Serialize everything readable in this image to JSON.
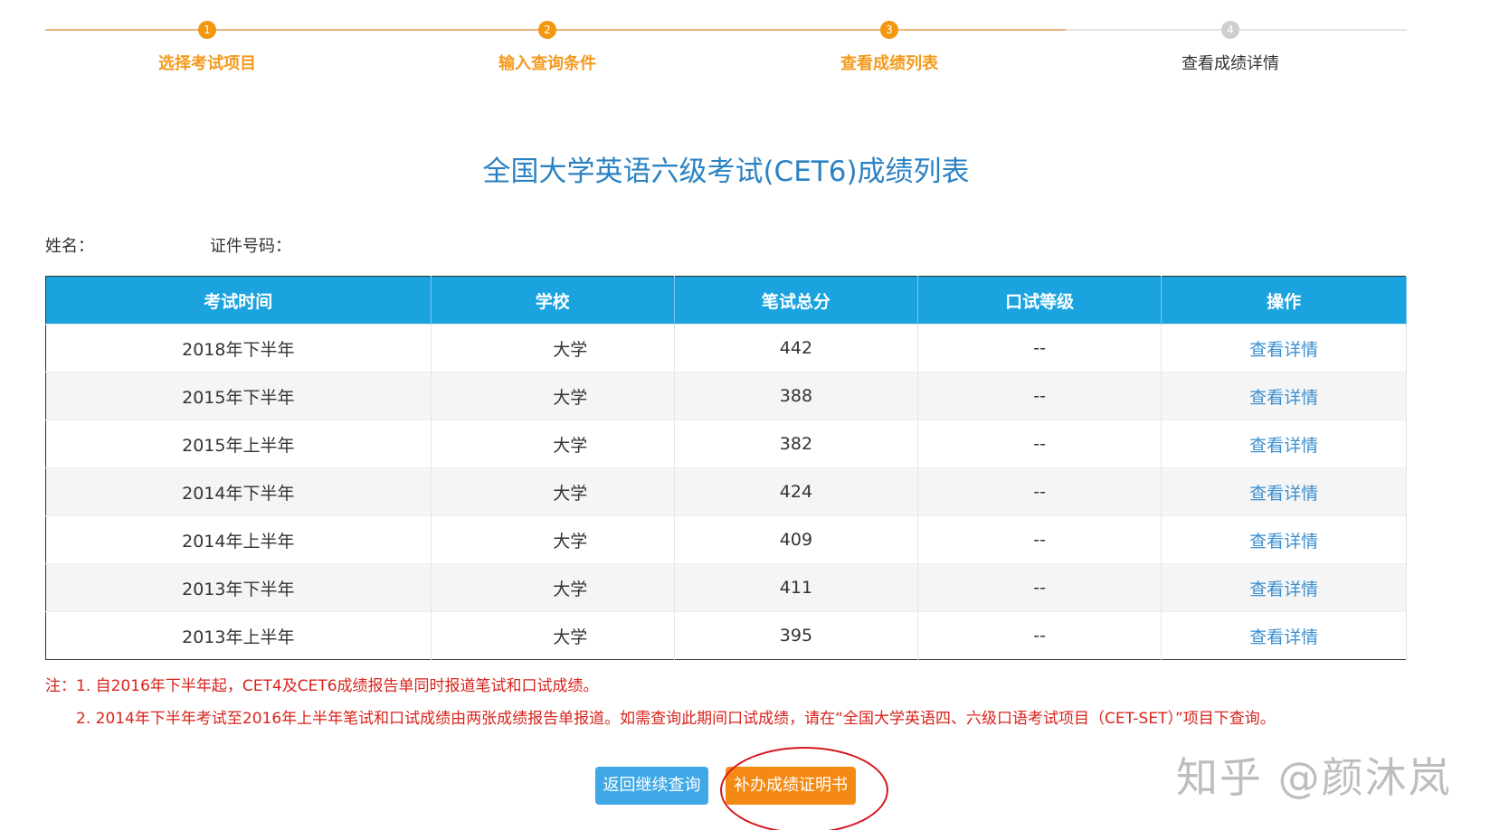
{
  "stepper": {
    "steps": [
      {
        "number": "1",
        "label": "选择考试项目"
      },
      {
        "number": "2",
        "label": "输入查询条件"
      },
      {
        "number": "3",
        "label": "查看成绩列表"
      },
      {
        "number": "4",
        "label": "查看成绩详情"
      }
    ]
  },
  "title": "全国大学英语六级考试(CET6)成绩列表",
  "info": {
    "name_label": "姓名：",
    "id_label": "证件号码："
  },
  "table": {
    "headers": [
      "考试时间",
      "学校",
      "笔试总分",
      "口试等级",
      "操作"
    ],
    "rows": [
      {
        "time": "2018年下半年",
        "school": "大学",
        "score": "442",
        "oral": "--",
        "action": "查看详情"
      },
      {
        "time": "2015年下半年",
        "school": "大学",
        "score": "388",
        "oral": "--",
        "action": "查看详情"
      },
      {
        "time": "2015年上半年",
        "school": "大学",
        "score": "382",
        "oral": "--",
        "action": "查看详情"
      },
      {
        "time": "2014年下半年",
        "school": "大学",
        "score": "424",
        "oral": "--",
        "action": "查看详情"
      },
      {
        "time": "2014年上半年",
        "school": "大学",
        "score": "409",
        "oral": "--",
        "action": "查看详情"
      },
      {
        "time": "2013年下半年",
        "school": "大学",
        "score": "411",
        "oral": "--",
        "action": "查看详情"
      },
      {
        "time": "2013年上半年",
        "school": "大学",
        "score": "395",
        "oral": "--",
        "action": "查看详情"
      }
    ]
  },
  "notes": {
    "note1": "注：1. 自2016年下半年起，CET4及CET6成绩报告单同时报道笔试和口试成绩。",
    "note2": "2. 2014年下半年考试至2016年上半年笔试和口试成绩由两张成绩报告单报道。如需查询此期间口试成绩，请在“全国大学英语四、六级口语考试项目（CET-SET）”项目下查询。"
  },
  "buttons": {
    "back": "返回继续查询",
    "certificate": "补办成绩证明书"
  },
  "watermark": "知乎 @颜沐岚",
  "colors": {
    "accent_orange": "#f39a1e",
    "header_blue": "#1ba3e0",
    "title_blue": "#2b82c3",
    "note_red": "#d8231b"
  }
}
